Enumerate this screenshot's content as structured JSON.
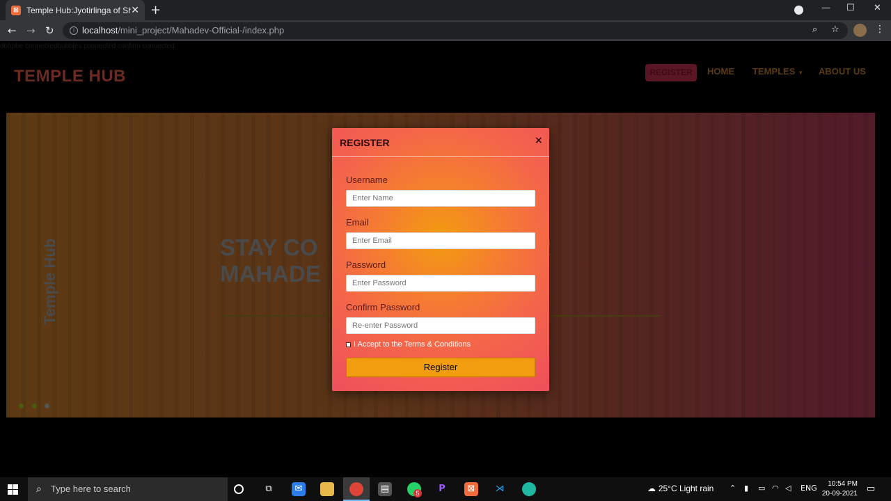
{
  "browser": {
    "tab_title": "Temple Hub:Jyotirlinga of Shiva",
    "url_host": "localhost",
    "url_path": "/mini_project/Mahadev-Official-/index.php"
  },
  "page": {
    "debug_text": "dbhpbe connectedbubbles connected confirm connected",
    "brand": "TEMPLE HUB",
    "nav": {
      "register": "REGISTER",
      "home": "HOME",
      "temples": "TEMPLES",
      "about": "ABOUT US"
    },
    "hero": {
      "side_text": "Temple Hub",
      "heading_line1": "STAY CO",
      "heading_line1_end": "R",
      "heading_line2": "MAHADE"
    },
    "dot_colors": [
      "#4a5a10",
      "#4a5a10",
      "#555555"
    ]
  },
  "modal": {
    "title": "REGISTER",
    "close": "×",
    "fields": [
      {
        "label": "Username",
        "placeholder": "Enter Name"
      },
      {
        "label": "Email",
        "placeholder": "Enter Email"
      },
      {
        "label": "Password",
        "placeholder": "Enter Password"
      },
      {
        "label": "Confirm Password",
        "placeholder": "Re-enter Password"
      }
    ],
    "terms": "I Accept to the Terms & Conditions",
    "submit": "Register"
  },
  "taskbar": {
    "search_placeholder": "Type here to search",
    "weather": "25°C  Light rain",
    "lang": "ENG",
    "time": "10:54 PM",
    "date": "20-09-2021",
    "whatsapp_badge": "5"
  }
}
